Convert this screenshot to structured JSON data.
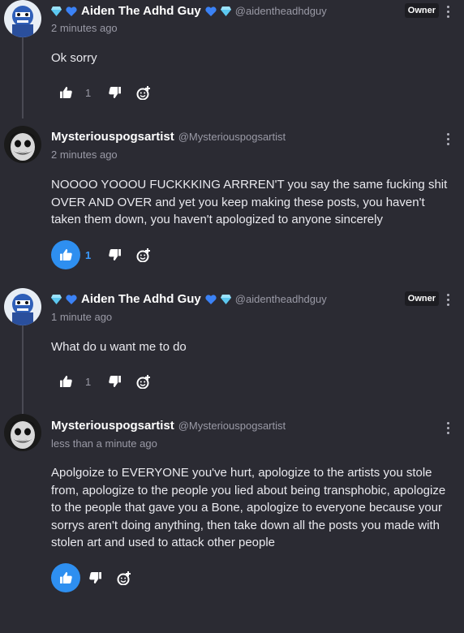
{
  "comments": [
    {
      "author": "Aiden The Adhd Guy",
      "handle": "@aidentheadhdguy",
      "badge": "Owner",
      "time": "2 minutes ago",
      "text": "Ok sorry",
      "likes": "1",
      "liked": false,
      "avatar": "blue-character-avatar",
      "decorations": [
        "gem-icon",
        "blue-heart-icon"
      ]
    },
    {
      "author": "Mysteriouspogsartist",
      "handle": "@Mysteriouspogsartist",
      "badge": "",
      "time": "2 minutes ago",
      "text": "NOOOO YOOOU FUCKKKING ARRREN'T you say the same fucking shit OVER AND OVER and yet you keep making these posts, you haven't taken them down, you haven't apologized to anyone sincerely",
      "likes": "1",
      "liked": true,
      "avatar": "grinning-face-avatar"
    },
    {
      "author": "Aiden The Adhd Guy",
      "handle": "@aidentheadhdguy",
      "badge": "Owner",
      "time": "1 minute ago",
      "text": "What do u want me to do",
      "likes": "1",
      "liked": false,
      "avatar": "blue-character-avatar",
      "decorations": [
        "gem-icon",
        "blue-heart-icon"
      ]
    },
    {
      "author": "Mysteriouspogsartist",
      "handle": "@Mysteriouspogsartist",
      "badge": "",
      "time": "less than a minute ago",
      "text": "Apolgoize to EVERYONE you've hurt, apologize to the artists you stole from, apologize to the people you lied about being transphobic, apologize to the people that gave you a Bone, apologize to everyone because your sorrys aren't doing anything, then take down all the posts you made with stolen art and used to attack other people",
      "likes": "",
      "liked": true,
      "avatar": "grinning-face-avatar"
    }
  ],
  "colors": {
    "background": "#2b2b33",
    "accent": "#2e8ff0",
    "muted": "#9a9aa6",
    "heart": "#3b82f6",
    "gem": "#5cc8f0"
  }
}
